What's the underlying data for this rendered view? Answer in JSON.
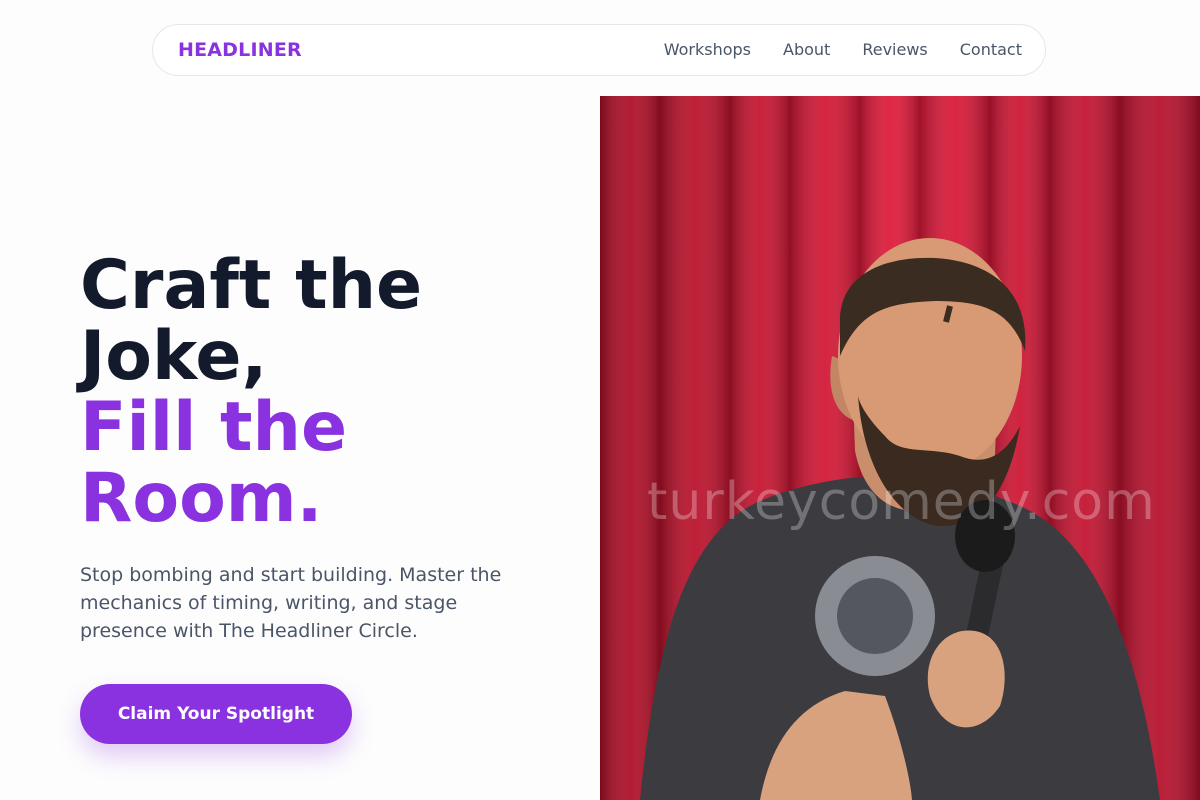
{
  "header": {
    "brand": "HEADLINER",
    "nav": [
      {
        "label": "Workshops"
      },
      {
        "label": "About"
      },
      {
        "label": "Reviews"
      },
      {
        "label": "Contact"
      }
    ]
  },
  "hero": {
    "title_line1": "Craft the",
    "title_line2": "Joke,",
    "title_line3": "Fill the",
    "title_line4": "Room.",
    "subtitle": "Stop bombing and start building. Master the mechanics of timing, writing, and stage presence with The Headliner Circle.",
    "cta_label": "Claim Your Spotlight",
    "image_watermark": "turkeycomedy.com"
  },
  "colors": {
    "accent": "#8a32e0",
    "heading": "#121a2c",
    "body_text": "#4a5568",
    "curtain": "#c8102e"
  }
}
